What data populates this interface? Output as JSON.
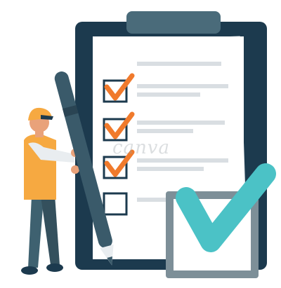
{
  "illustration": {
    "subject": "worker-with-pen-and-checklist",
    "checklist_rows": [
      {
        "checked": true
      },
      {
        "checked": true
      },
      {
        "checked": true
      },
      {
        "checked": false
      }
    ],
    "watermark": "canva",
    "colors": {
      "board": "#1c3a4e",
      "clip": "#4a6b7a",
      "paper": "#ffffff",
      "paper_shadow": "#eef1f3",
      "text_lines": "#d9dee2",
      "check_orange": "#f07a2c",
      "box_outline": "#1c3a4e",
      "big_check_teal": "#4bc2c6",
      "big_box_gray": "#7d8f98",
      "worker_shirt": "#f6a941",
      "worker_sleeve": "#e9edf0",
      "worker_pants": "#3e6170",
      "worker_skin": "#e9a27a",
      "cap": "#f6a941",
      "pen": "#3a5a6a"
    }
  }
}
